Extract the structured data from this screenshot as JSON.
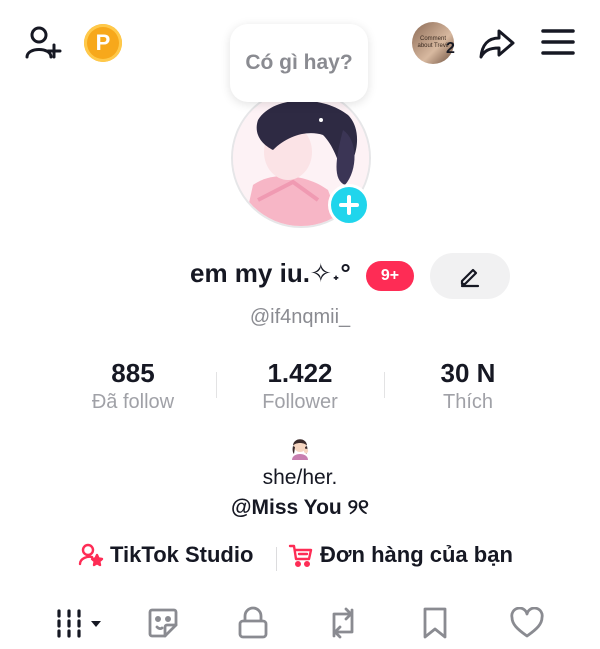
{
  "header": {
    "coin_letter": "P",
    "story_thumb_text": "Comment about Trevii",
    "story_count": "2"
  },
  "tooltip": {
    "text": "Có gì hay?"
  },
  "profile": {
    "name": "em my iu.✧˖°",
    "notification_badge": "9+",
    "handle": "@if4nqmii_"
  },
  "stats": [
    {
      "value": "885",
      "label": "Đã follow"
    },
    {
      "value": "1.422",
      "label": "Follower"
    },
    {
      "value": "30 N",
      "label": "Thích"
    }
  ],
  "bio": {
    "line1": "she/her.",
    "mention": "@Miss You ୨୧"
  },
  "links": {
    "studio": "TikTok Studio",
    "orders": "Đơn hàng của bạn"
  },
  "colors": {
    "accent_pink": "#fe2c55",
    "accent_cyan": "#20d5ec",
    "coin_orange": "#f7a81b",
    "muted_text": "#8a8b91"
  },
  "icons": [
    "add-friend-icon",
    "coin-icon",
    "share-icon",
    "menu-icon",
    "plus-icon",
    "edit-icon",
    "creator-star-icon",
    "cart-icon",
    "grid-icon",
    "sticker-icon",
    "lock-icon",
    "repost-icon",
    "bookmark-icon",
    "heart-icon"
  ]
}
